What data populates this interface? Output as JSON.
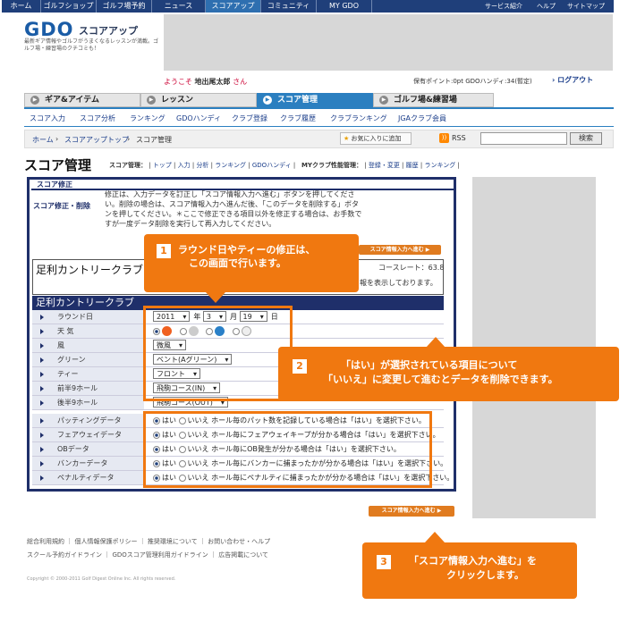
{
  "topnav": {
    "items": [
      "ホーム",
      "ゴルフショップ",
      "ゴルフ場予約",
      "ニュース",
      "スコアアップ",
      "コミュニティ",
      "MY GDO"
    ],
    "right": [
      "サービス紹介",
      "ヘルプ",
      "サイトマップ"
    ]
  },
  "header": {
    "logo": "GDO",
    "logo_sub": "スコアアップ",
    "tagline": "最新ギア情報やゴルフがうまくなるレッスンが満載。ゴルフ場・練習場のクチコミも！",
    "welcome_prefix": "ようこそ",
    "user_name": "地出尾太郎",
    "welcome_suffix": "さん",
    "points_text": "保有ポイント:0pt  GDOハンディ:34(暫定)",
    "logout": "ログアウト"
  },
  "maintabs": [
    "ギア&アイテム",
    "レッスン",
    "スコア管理",
    "ゴルフ場&練習場"
  ],
  "subnav": [
    "スコア入力",
    "スコア分析",
    "ランキング",
    "GDOハンディ",
    "クラブ登録",
    "クラブ履歴",
    "クラブランキング",
    "JGAクラブ会員"
  ],
  "breadcrumb": {
    "home": "ホーム",
    "top": "スコアアップトップ",
    "current": "スコア管理",
    "fav": "お気に入りに追加",
    "rss": "RSS",
    "search_btn": "検索"
  },
  "page": {
    "title": "スコア管理",
    "score_links_label": "スコア管理：",
    "score_links": [
      "トップ",
      "入力",
      "分析",
      "ランキング",
      "GDOハンディ"
    ],
    "club_links_label": "MYクラブ性能管理：",
    "club_links": [
      "登録・変更",
      "履歴",
      "ランキング"
    ]
  },
  "modpanel": {
    "header": "スコア修正",
    "label": "スコア修正・削除",
    "text": "修正は、入力データを訂正し「スコア情報入力へ進む」ボタンを押してください。削除の場合は、スコア情報入力へ進んだ後、「このデータを削除する」ボタンを押してください。＊ここで修正できる項目以外を修正する場合は、お手数ですが一度データ削除を実行して再入力してください。",
    "next_button": "スコア情報入力へ進む ▶",
    "course_name": "足利カントリークラブ",
    "course_rate": "コースレート：63.8",
    "course_note": "報を表示しております。"
  },
  "form": {
    "rows": [
      {
        "label": "ラウンド日"
      },
      {
        "label": "天 気"
      },
      {
        "label": "風"
      },
      {
        "label": "グリーン"
      },
      {
        "label": "ティー"
      },
      {
        "label": "前半9ホール"
      },
      {
        "label": "後半9ホール"
      },
      {
        "label": "パッティングデータ"
      },
      {
        "label": "フェアウェイデータ"
      },
      {
        "label": "OBデータ"
      },
      {
        "label": "バンカーデータ"
      },
      {
        "label": "ペナルティデータ"
      }
    ],
    "year": "2011",
    "year_unit": "年",
    "month": "3",
    "month_unit": "月",
    "day": "19",
    "day_unit": "日",
    "wind": "微風",
    "green": "ベント(Aグリーン)",
    "tee": "フロント",
    "front9": "飛駒コース(IN)",
    "back9": "飛駒コース(OUT)",
    "yes": "はい",
    "no": "いいえ",
    "yn_notes": [
      "ホール毎のパット数を記録している場合は「はい」を選択下さい。",
      "ホール毎にフェアウェイキープが分かる場合は「はい」を選択下さい。",
      "ホール毎にOB発生が分かる場合は「はい」を選択下さい。",
      "ホール毎にバンカーに捕まったかが分かる場合は「はい」を選択下さい。",
      "ホール毎にペナルティに捕まったかが分かる場合は「はい」を選択下さい。"
    ]
  },
  "callouts": {
    "c1_num": "1",
    "c1_line1": "ラウンド日やティーの修正は、",
    "c1_line2": "この画面で行います。",
    "c2_num": "2",
    "c2_line1": "「はい」が選択されている項目について",
    "c2_line2": "「いいえ」に変更して進むとデータを削除できます。",
    "c3_num": "3",
    "c3_line1": "「スコア情報入力へ進む」を",
    "c3_line2": "クリックします。"
  },
  "footer": {
    "line1": "総合利用規約 ｜ 個人情報保護ポリシー ｜ 推奨環境について ｜ お問い合わせ・ヘルプ",
    "line2": "スクール予約ガイドライン ｜ GDOスコア管理利用ガイドライン ｜ 広告掲載について",
    "copyright": "Copyright © 2000-2011 Golf Digest Online Inc. All rights reserved."
  },
  "colors": {
    "accent": "#f07810",
    "navy": "#1f2f6a",
    "blue": "#2b7fc0"
  }
}
